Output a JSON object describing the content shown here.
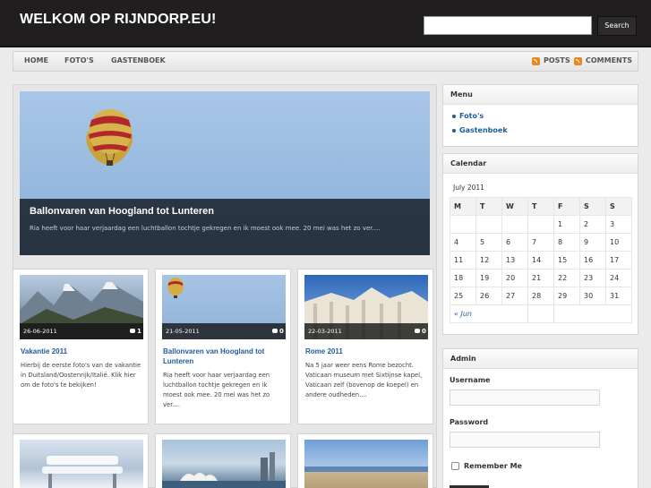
{
  "site_title": "WELKOM OP RIJNDORP.EU!",
  "search": {
    "placeholder": "",
    "button": "Search"
  },
  "nav": {
    "items": [
      "HOME",
      "FOTO'S",
      "GASTENBOEK"
    ],
    "feeds": [
      "POSTS",
      "COMMENTS"
    ]
  },
  "featured": {
    "title": "Ballonvaren van Hoogland tot Lunteren",
    "excerpt": "Ria heeft voor haar verjaardag een luchtballon tochtje gekregen en ik moest ook mee. 20 mei was het zo ver...."
  },
  "posts": [
    {
      "date": "26-06-2011",
      "comments": "1",
      "title": "Vakantie 2011",
      "excerpt": "Hierbij de eerste foto's van de vakantie in Duitsland/Oostenrijk/Italië. Klik hier om de foto's te bekijken!"
    },
    {
      "date": "21-05-2011",
      "comments": "0",
      "title": "Ballonvaren van Hoogland tot Lunteren",
      "excerpt": "Ria heeft voor haar verjaardag een luchtballon tochtje gekregen en ik moest ook mee. 20 mei was het zo ver...."
    },
    {
      "date": "22-03-2011",
      "comments": "0",
      "title": "Rome 2011",
      "excerpt": "Na 5 jaar weer eens Rome bezocht. Vaticaan museum met Sixtijnse kapel, Vaticaan zelf (bovenop de koepel) en andere oudheden...."
    }
  ],
  "sidebar": {
    "menu": {
      "title": "Menu",
      "items": [
        "Foto's",
        "Gastenboek"
      ]
    },
    "calendar": {
      "title": "Calendar",
      "caption": "July 2011",
      "headers": [
        "M",
        "T",
        "W",
        "T",
        "F",
        "S",
        "S"
      ],
      "rows": [
        [
          "",
          "",
          "",
          "",
          "1",
          "2",
          "3"
        ],
        [
          "4",
          "5",
          "6",
          "7",
          "8",
          "9",
          "10"
        ],
        [
          "11",
          "12",
          "13",
          "14",
          "15",
          "16",
          "17"
        ],
        [
          "18",
          "19",
          "20",
          "21",
          "22",
          "23",
          "24"
        ],
        [
          "25",
          "26",
          "27",
          "28",
          "29",
          "30",
          "31"
        ]
      ],
      "prev": "« Jun"
    },
    "admin": {
      "title": "Admin",
      "username_label": "Username",
      "password_label": "Password",
      "remember_label": "Remember Me"
    }
  },
  "colors": {
    "header": "#201e1e",
    "link": "#1e5d9b",
    "rss": "#e8891e"
  }
}
